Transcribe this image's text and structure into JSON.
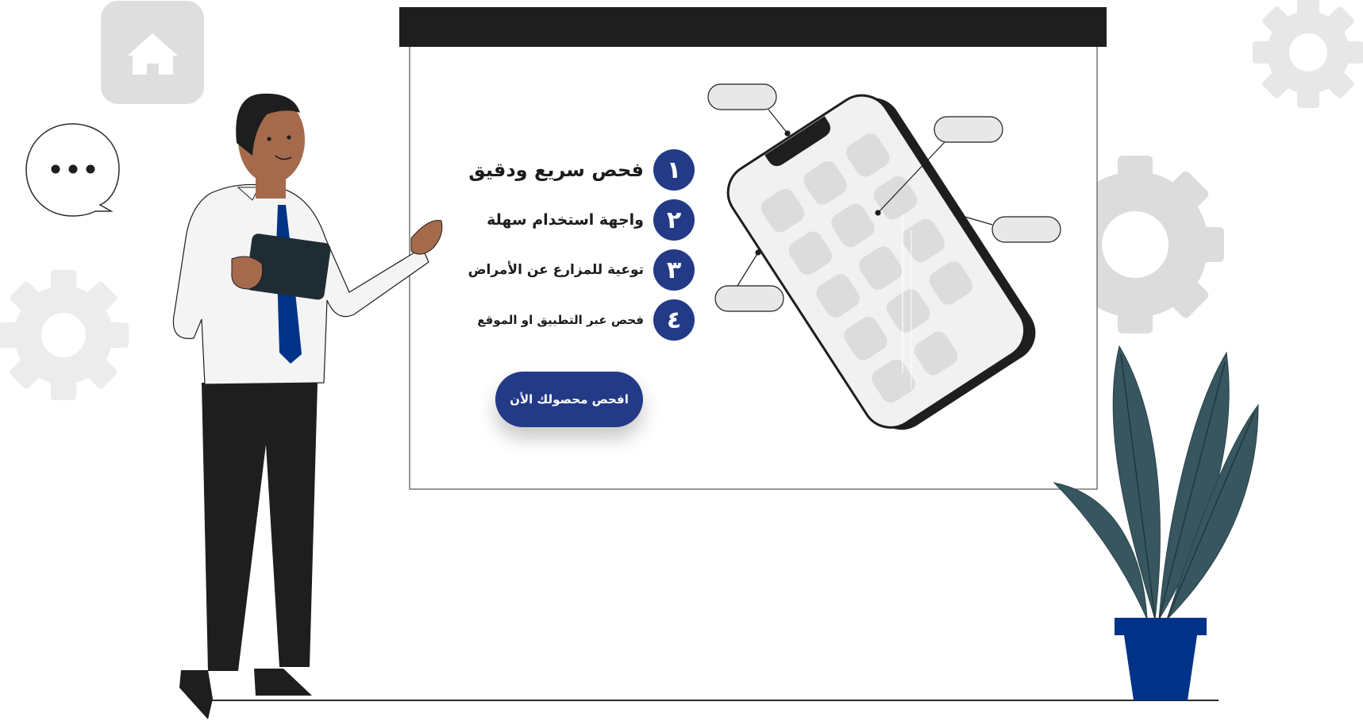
{
  "features": [
    {
      "number": "١",
      "label": "فحص سريع ودقيق"
    },
    {
      "number": "٢",
      "label": "واجهة استخدام سهلة"
    },
    {
      "number": "٣",
      "label": "توعية للمزارع عن الأمراض"
    },
    {
      "number": "٤",
      "label": "فحص عبر التطبيق او الموقع"
    }
  ],
  "cta": {
    "label": "افحص محصولك الأن"
  },
  "colors": {
    "accent": "#233a87",
    "board_bar": "#1e1e1e",
    "plant_leaf": "#37565f",
    "pot": "#003387",
    "icon_gray": "#d9d9d9"
  },
  "icons": [
    "home-icon",
    "chat-bubble-icon",
    "gear-icon"
  ]
}
